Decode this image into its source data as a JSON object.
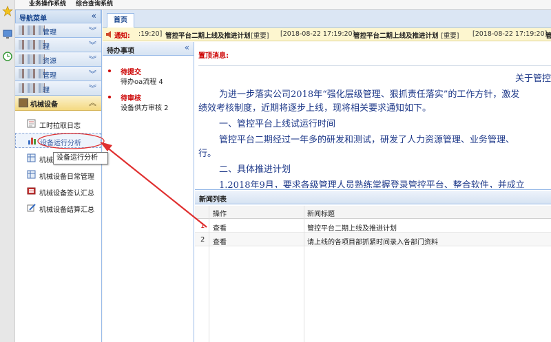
{
  "topbar": {
    "item1": "业务操作系统",
    "item2": "综合查询系统"
  },
  "nav": {
    "header": "导航菜单",
    "collapse_glyph": "«",
    "groups": [
      {
        "label": "管理"
      },
      {
        "label": "理"
      },
      {
        "label": "资源"
      },
      {
        "label": "管理"
      },
      {
        "label": "理"
      }
    ],
    "active_group": "机械设备",
    "sub_items": [
      {
        "label": "工时拉取日志",
        "icon": "document-icon"
      },
      {
        "label": "设备运行分析",
        "icon": "bar-chart-icon"
      },
      {
        "label": "机械",
        "icon": "table-icon"
      },
      {
        "label": "机械设备日常管理",
        "icon": "table-icon"
      },
      {
        "label": "机械设备签认汇总",
        "icon": "stamp-icon"
      },
      {
        "label": "机械设备结算汇总",
        "icon": "edit-icon"
      }
    ]
  },
  "tooltip": "设备运行分析",
  "tabs": {
    "home": "首页"
  },
  "ticker": {
    "notice": "通知:",
    "time1": ":19:20]",
    "title1": "管控平台二期上线及推进计划",
    "tag1": "[重要]",
    "time2": "[2018-08-22 17:19:20]",
    "title2": "管控平台二期上线及推进计划",
    "tag2": "[重要]",
    "time3": "[2018-08-22 17:19:20]",
    "title3": "管控平台二"
  },
  "todo": {
    "header": "待办事项",
    "sections": [
      {
        "title": "待提交",
        "item": "待办oa流程 4"
      },
      {
        "title": "待审核",
        "item": "设备供方审核 2"
      }
    ]
  },
  "announcement": {
    "label": "置顶消息:",
    "title": "关于管控",
    "lines": [
      "为进一步落实公司2018年“强化层级管理、狠抓责任落实”的工作方针，激发",
      "绩效考核制度，近期将逐步上线，现将相关要求通知如下。",
      "一、管控平台上线试运行时间",
      "管控平台二期经过一年多的研发和测试，研发了人力资源管理、业务管理、",
      "行。",
      "二、具体推进计划",
      "1.2018年9月，要求各级管理人员熟练掌握登录管控平台、整合软件，并成立"
    ]
  },
  "news": {
    "header": "新闻列表",
    "columns": [
      "操作",
      "新闻标题"
    ],
    "rows": [
      {
        "num": "1",
        "action": "查看",
        "title": "管控平台二期上线及推进计划"
      },
      {
        "num": "2",
        "action": "查看",
        "title": "请上线的各项目部抓紧时间录入各部门资料"
      }
    ]
  },
  "colors": {
    "accent": "#15428b",
    "alert": "#cc0000",
    "annotation": "#e03030"
  }
}
